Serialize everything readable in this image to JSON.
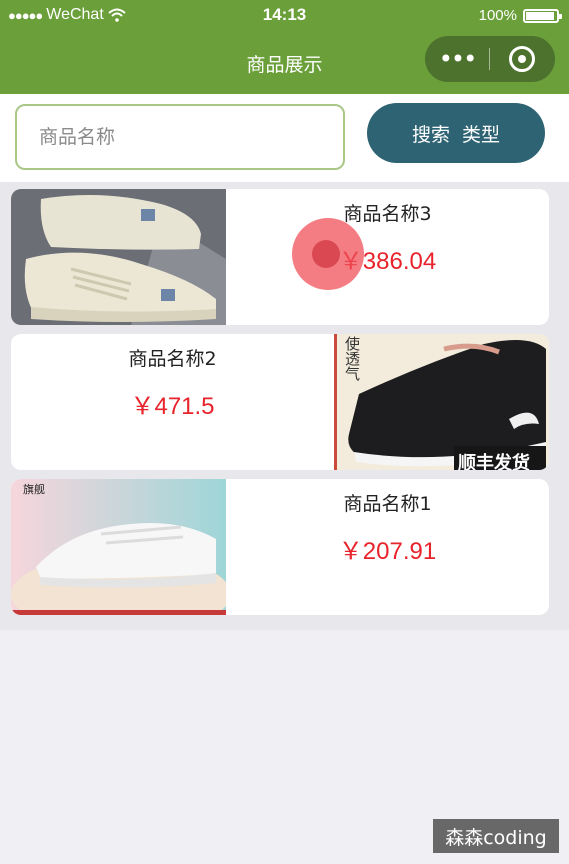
{
  "status_bar": {
    "signal_dots": "●●●●●",
    "carrier": "WeChat",
    "wifi_icon": "wifi-icon",
    "time": "14:13",
    "battery": "100%"
  },
  "nav": {
    "title": "商品展示",
    "more_glyph": "•••"
  },
  "search": {
    "placeholder": "商品名称",
    "value": "",
    "button_labels": [
      "搜索",
      "类型"
    ]
  },
  "products": [
    {
      "name": "商品名称3",
      "price": "￥386.04",
      "image_side": "left",
      "image_icon": "beige-sneaker-image"
    },
    {
      "name": "商品名称2",
      "price": "￥471.5",
      "image_side": "right",
      "image_icon": "black-slip-on-shoe-image",
      "image_caption": "顺丰发货",
      "image_text": "使透气"
    },
    {
      "name": "商品名称1",
      "price": "￥207.91",
      "image_side": "left",
      "image_icon": "white-sneaker-image",
      "image_badge": "旗舰"
    }
  ],
  "watermark": "森森coding",
  "colors": {
    "nav_green": "#6a9f3a",
    "button_teal": "#2e6374",
    "price_red": "#e8232c"
  }
}
